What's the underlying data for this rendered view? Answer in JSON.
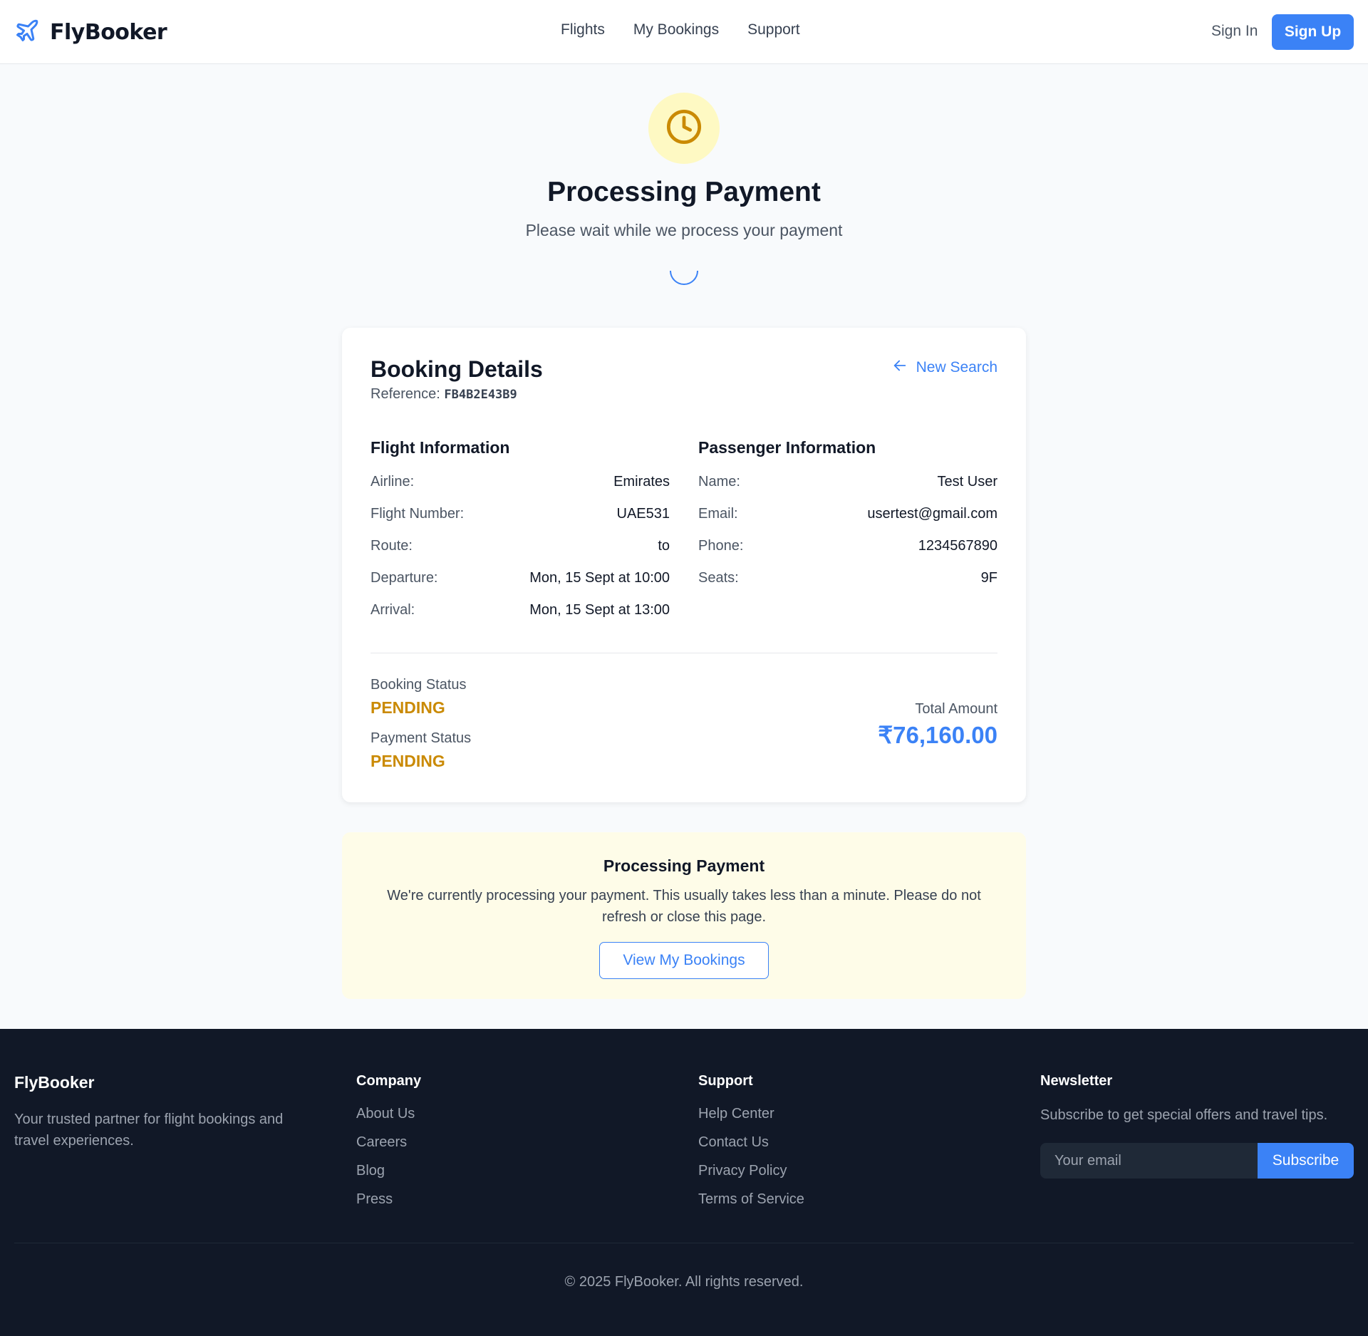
{
  "brand": "FlyBooker",
  "nav": {
    "flights": "Flights",
    "my_bookings": "My Bookings",
    "support": "Support",
    "sign_in": "Sign In",
    "sign_up": "Sign Up"
  },
  "hero": {
    "title": "Processing Payment",
    "subtitle": "Please wait while we process your payment"
  },
  "booking": {
    "title": "Booking Details",
    "ref_label": "Reference:",
    "ref_code": "FB4B2E43B9",
    "new_search": "New Search",
    "flight_heading": "Flight Information",
    "passenger_heading": "Passenger Information",
    "flight_rows": [
      {
        "label": "Airline:",
        "value": "Emirates"
      },
      {
        "label": "Flight Number:",
        "value": "UAE531"
      },
      {
        "label": "Route:",
        "value": "to"
      },
      {
        "label": "Departure:",
        "value": "Mon, 15 Sept at 10:00"
      },
      {
        "label": "Arrival:",
        "value": "Mon, 15 Sept at 13:00"
      }
    ],
    "passenger_rows": [
      {
        "label": "Name:",
        "value": "Test User"
      },
      {
        "label": "Email:",
        "value": "usertest@gmail.com"
      },
      {
        "label": "Phone:",
        "value": "1234567890"
      },
      {
        "label": "Seats:",
        "value": "9F"
      }
    ],
    "booking_status_label": "Booking Status",
    "booking_status": "PENDING",
    "payment_status_label": "Payment Status",
    "payment_status": "PENDING",
    "total_label": "Total Amount",
    "total_amount": "₹76,160.00"
  },
  "notice": {
    "title": "Processing Payment",
    "text": "We're currently processing your payment. This usually takes less than a minute. Please do not refresh or close this page.",
    "button": "View My Bookings"
  },
  "footer": {
    "brand": "FlyBooker",
    "description": "Your trusted partner for flight bookings and travel experiences.",
    "company_heading": "Company",
    "company_links": [
      "About Us",
      "Careers",
      "Blog",
      "Press"
    ],
    "support_heading": "Support",
    "support_links": [
      "Help Center",
      "Contact Us",
      "Privacy Policy",
      "Terms of Service"
    ],
    "newsletter_heading": "Newsletter",
    "newsletter_text": "Subscribe to get special offers and travel tips.",
    "email_placeholder": "Your email",
    "subscribe": "Subscribe",
    "copyright": "© 2025 FlyBooker. All rights reserved."
  },
  "icons": {
    "logo": "plane-icon",
    "status": "clock-icon",
    "back": "arrow-left-icon",
    "loading": "spinner-icon"
  },
  "colors": {
    "accent": "#3b82f6",
    "pending": "#ca8a04",
    "status_bg": "#fef9c3",
    "notice_bg": "#fefce8",
    "footer_bg": "#111827"
  }
}
